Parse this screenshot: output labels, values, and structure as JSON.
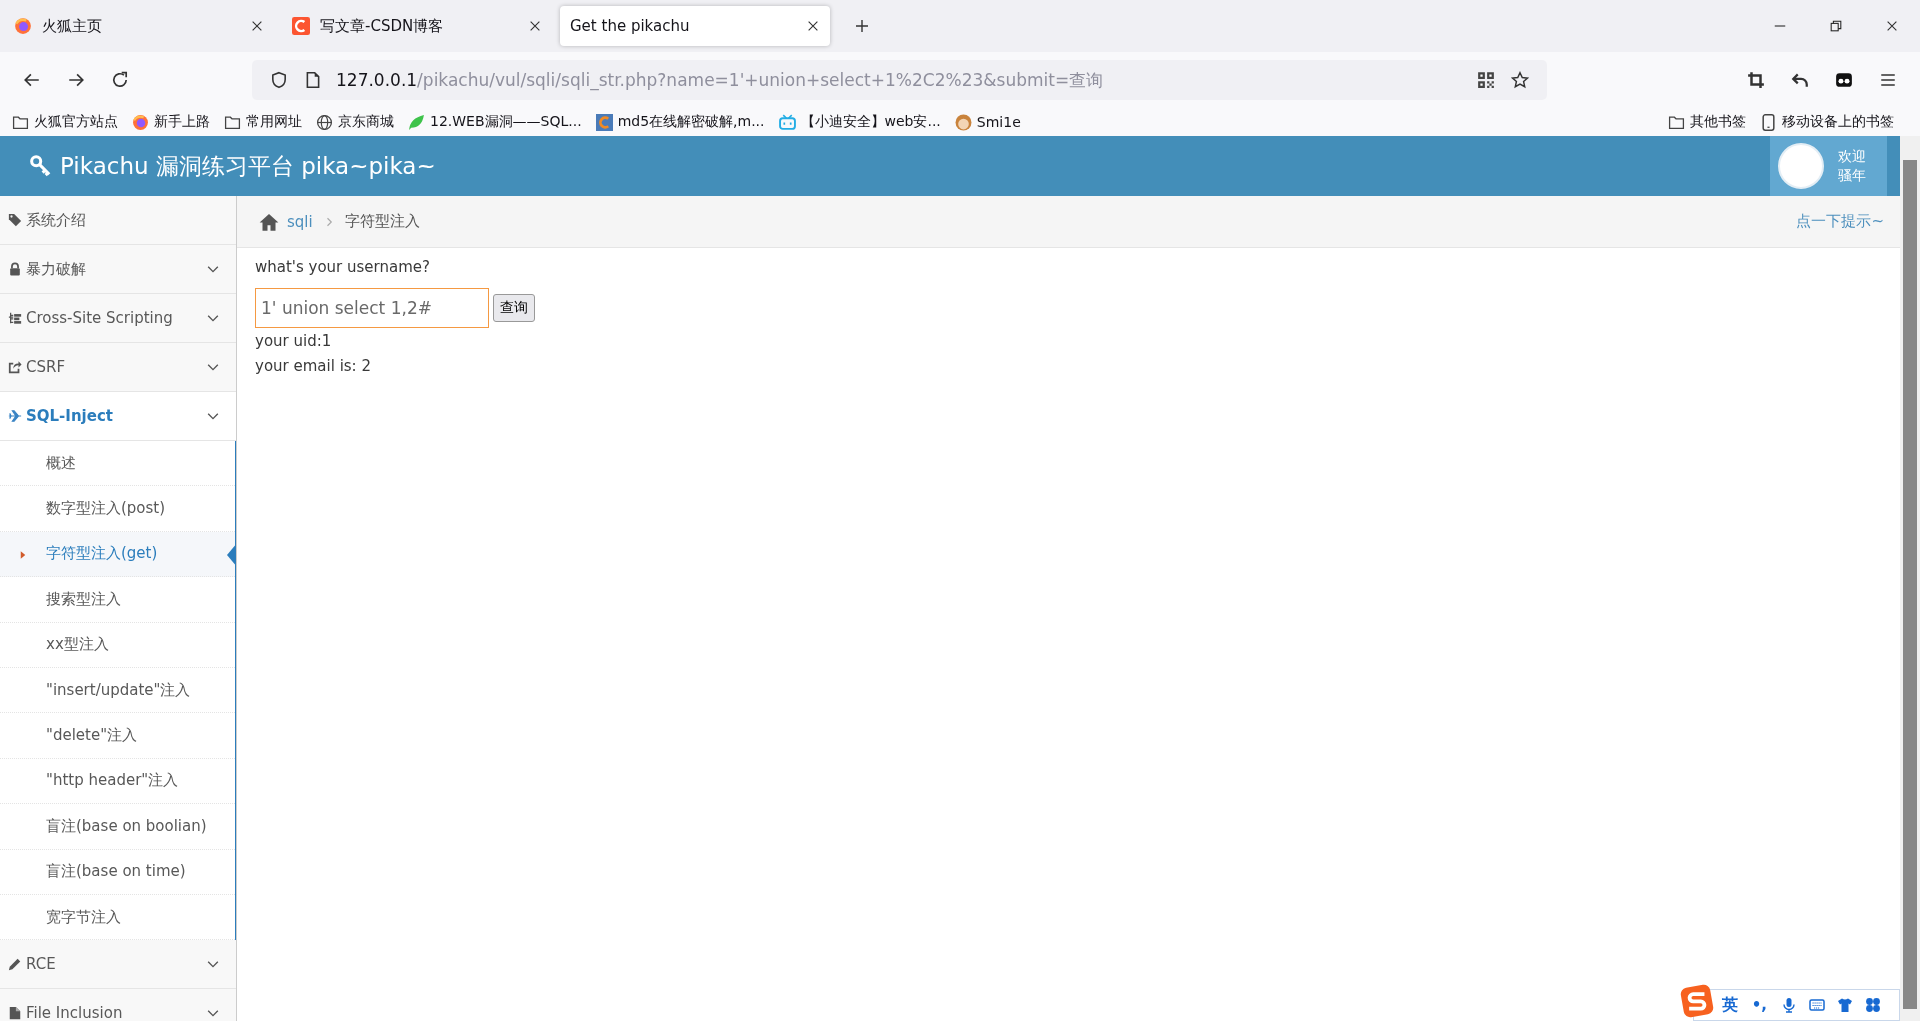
{
  "browser": {
    "tabs": [
      {
        "title": "火狐主页",
        "selected": false
      },
      {
        "title": "写文章-CSDN博客",
        "selected": false
      },
      {
        "title": "Get the pikachu",
        "selected": true
      }
    ],
    "address": {
      "host": "127.0.0.1",
      "path": "/pikachu/vul/sqli/sqli_str.php?name=1'+union+select+1%2C2%23&submit=查询"
    },
    "bookmarks": [
      "火狐官方站点",
      "新手上路",
      "常用网址",
      "京东商城",
      "12.WEB漏洞——SQL...",
      "md5在线解密破解,m...",
      "【小迪安全】web安...",
      "Smi1e"
    ],
    "bookmarks_right": [
      "其他书签",
      "移动设备上的书签"
    ]
  },
  "page": {
    "header": {
      "title": "Pikachu 漏洞练习平台 pika~pika~",
      "greeting": [
        "欢迎",
        "骚年"
      ]
    },
    "sidebar": [
      {
        "label": "系统介绍",
        "expandable": false,
        "expanded": false
      },
      {
        "label": "暴力破解",
        "expandable": true,
        "expanded": false
      },
      {
        "label": "Cross-Site Scripting",
        "expandable": true,
        "expanded": false
      },
      {
        "label": "CSRF",
        "expandable": true,
        "expanded": false
      },
      {
        "label": "SQL-Inject",
        "expandable": true,
        "expanded": true,
        "children": [
          {
            "label": "概述",
            "selected": false
          },
          {
            "label": "数字型注入(post)",
            "selected": false
          },
          {
            "label": "字符型注入(get)",
            "selected": true
          },
          {
            "label": "搜索型注入",
            "selected": false
          },
          {
            "label": "xx型注入",
            "selected": false
          },
          {
            "label": "\"insert/update\"注入",
            "selected": false
          },
          {
            "label": "\"delete\"注入",
            "selected": false
          },
          {
            "label": "\"http header\"注入",
            "selected": false
          },
          {
            "label": "盲注(base on boolian)",
            "selected": false
          },
          {
            "label": "盲注(base on time)",
            "selected": false
          },
          {
            "label": "宽字节注入",
            "selected": false
          }
        ]
      },
      {
        "label": "RCE",
        "expandable": true,
        "expanded": false
      },
      {
        "label": "File Inclusion",
        "expandable": true,
        "expanded": false
      }
    ],
    "breadcrumb": {
      "link": "sqli",
      "current": "字符型注入"
    },
    "hint": "点一下提示~",
    "form": {
      "prompt": "what's your username?",
      "value": "1' union select 1,2#",
      "button": "查询"
    },
    "results": [
      "your uid:1",
      "your email is: 2"
    ]
  },
  "ime": {
    "mode": "英",
    "punctuation": "•,"
  }
}
